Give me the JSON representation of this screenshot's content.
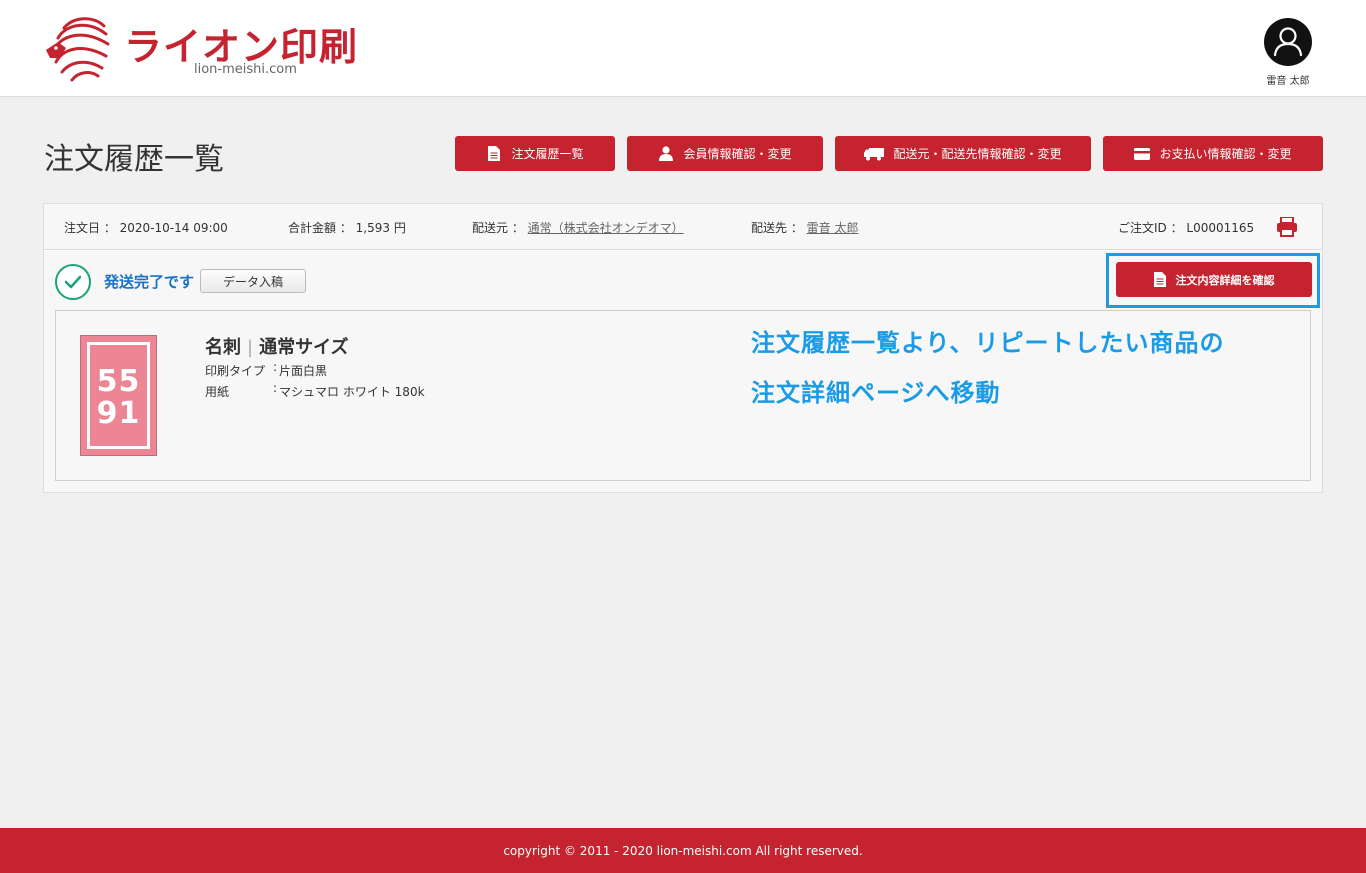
{
  "header": {
    "brand": "ライオン印刷",
    "domain": "lion-meishi.com",
    "user_name": "雷音 太郎"
  },
  "page": {
    "title": "注文履歴一覧"
  },
  "nav": [
    {
      "label": "注文履歴一覧",
      "icon": "document-icon"
    },
    {
      "label": "会員情報確認・変更",
      "icon": "person-icon"
    },
    {
      "label": "配送元・配送先情報確認・変更",
      "icon": "truck-icon"
    },
    {
      "label": "お支払い情報確認・変更",
      "icon": "credit-card-icon"
    }
  ],
  "order": {
    "date_label": "注文日",
    "date": "2020-10-14 09:00",
    "total_label": "合計金額",
    "total": "1,593 円",
    "from_label": "配送元",
    "from": "通常（株式会社オンデオマ）",
    "to_label": "配送先",
    "to": "雷音 太郎",
    "id_label": "ご注文ID",
    "id": "L00001165",
    "status": "発送完了です",
    "data_button": "データ入稿",
    "detail_button": "注文内容詳細を確認"
  },
  "item": {
    "category": "名刺",
    "size": "通常サイズ",
    "thumb_top": "55",
    "thumb_bottom": "91",
    "specs": [
      {
        "key": "印刷タイプ",
        "value": "片面白黒"
      },
      {
        "key": "用紙",
        "value": "マシュマロ ホワイト 180k"
      }
    ]
  },
  "annotation": {
    "line1": "注文履歴一覧より、リピートしたい商品の",
    "line2": "注文詳細ページへ移動"
  },
  "footer": {
    "copyright": "copyright © 2011 - 2020 lion-meishi.com All right reserved."
  },
  "colors": {
    "brand_red": "#c4232f",
    "status_blue": "#1a72c7",
    "annotation_blue": "#1a9be6",
    "check_green": "#1aa37a"
  }
}
